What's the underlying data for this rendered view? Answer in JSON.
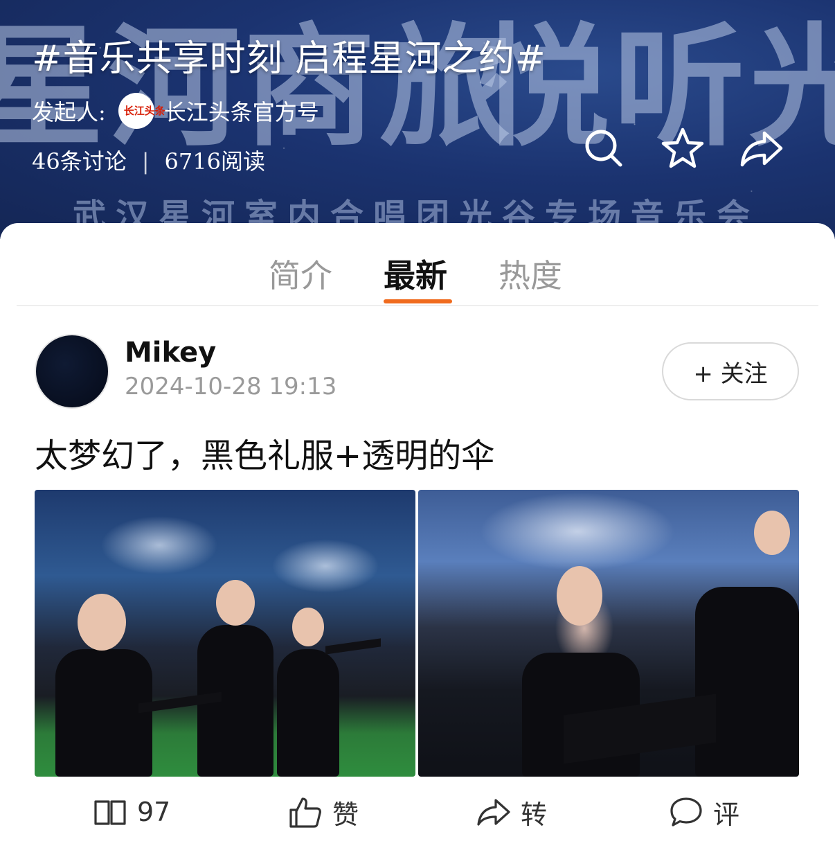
{
  "header": {
    "topic_title": "#音乐共享时刻 启程星河之约#",
    "initiator_label": "发起人:",
    "initiator_logo_text": "长江头条",
    "initiator_name": "长江头条官方号",
    "discussions": "46条讨论",
    "stat_separator": "|",
    "reads": "6716阅读",
    "banner_left_text": "星河商旅",
    "banner_right_text": "悦听光谷",
    "banner_sub_text": "武汉星河室内合唱团光谷专场音乐会",
    "actions": [
      "search-icon",
      "star-icon",
      "share-icon"
    ]
  },
  "tabs": [
    {
      "label": "简介",
      "active": false
    },
    {
      "label": "最新",
      "active": true
    },
    {
      "label": "热度",
      "active": false
    }
  ],
  "post": {
    "author": "Mikey",
    "time": "2024-10-28 19:13",
    "follow_label": "+ 关注",
    "text": "太梦幻了，黑色礼服+透明的伞",
    "photos": [
      "choir-performers-with-umbrellas",
      "smiling-singer-with-umbrella"
    ]
  },
  "actions": {
    "reads": "97",
    "like": "赞",
    "repost": "转",
    "comment": "评"
  },
  "colors": {
    "accent": "#f06b1e",
    "banner": "#1b3370",
    "muted_text": "#999999"
  }
}
